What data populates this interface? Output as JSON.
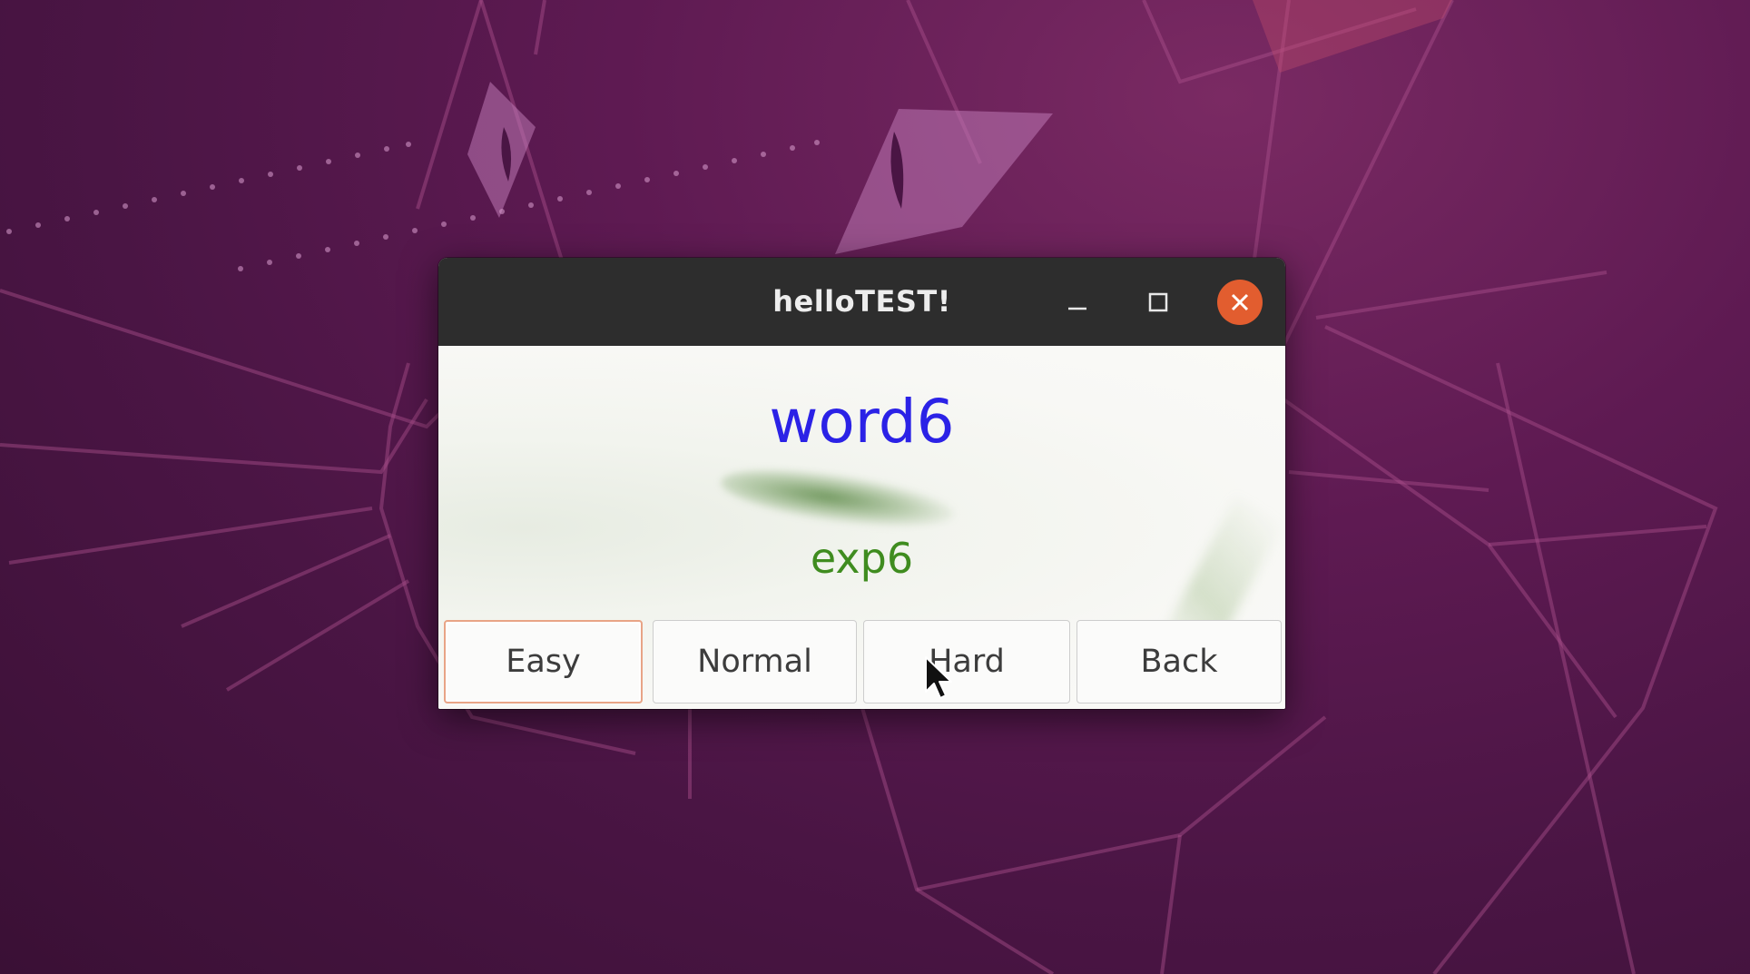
{
  "window": {
    "title": "helloTEST!"
  },
  "titlebar_buttons": {
    "minimize_icon": "minimize-icon",
    "maximize_icon": "maximize-icon",
    "close_icon": "close-icon"
  },
  "card": {
    "word": "word6",
    "explanation": "exp6"
  },
  "buttons": {
    "easy": "Easy",
    "normal": "Normal",
    "hard": "Hard",
    "back": "Back"
  },
  "colors": {
    "word": "#2b22e6",
    "explanation": "#3f8c1f",
    "close_button": "#e25d2f",
    "titlebar": "#2d2d2d",
    "focused_button_border": "#e8a486"
  }
}
